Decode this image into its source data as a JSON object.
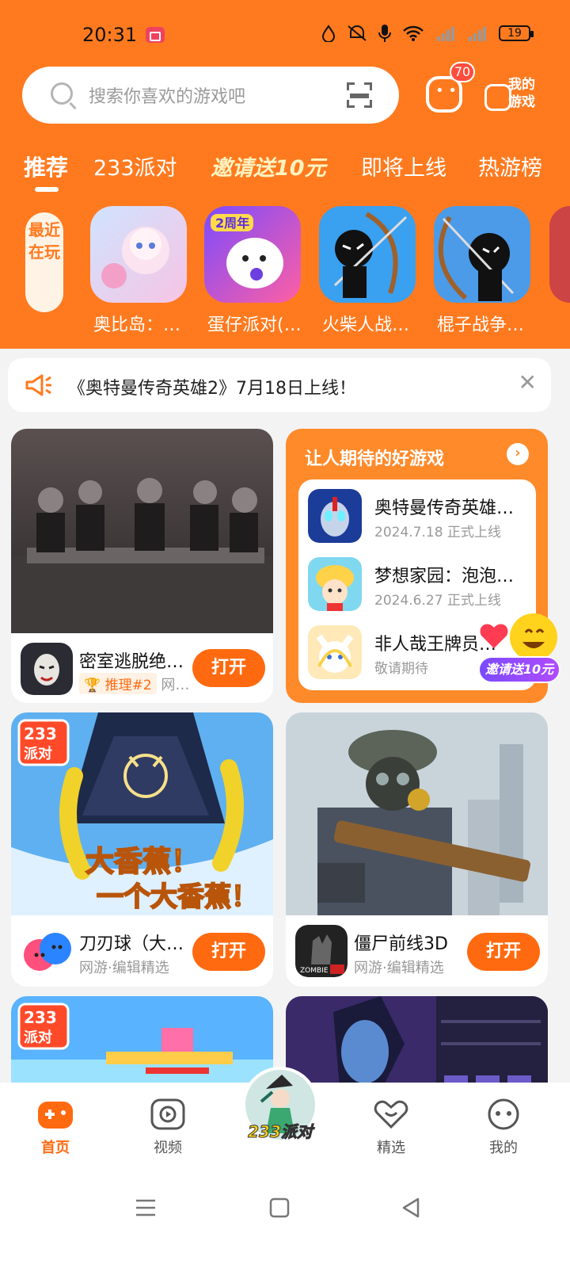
{
  "status": {
    "time": "20:31",
    "battery": "19"
  },
  "search": {
    "placeholder": "搜索你喜欢的游戏吧"
  },
  "messages": {
    "badge": "70"
  },
  "my_games": {
    "label": "我的游戏"
  },
  "tabs": [
    {
      "label": "推荐"
    },
    {
      "label": "233派对"
    },
    {
      "label": "邀请送10元"
    },
    {
      "label": "即将上线"
    },
    {
      "label": "热游榜"
    }
  ],
  "recent": {
    "label": "最近在玩",
    "items": [
      {
        "name": "奥比岛：…"
      },
      {
        "name": "蛋仔派对(…"
      },
      {
        "name": "火柴人战…"
      },
      {
        "name": "棍子战争…"
      }
    ]
  },
  "notice": {
    "text": "《奥特曼传奇英雄2》7月18日上线！"
  },
  "cards": [
    {
      "name": "密室逃脱绝…",
      "rank": "推理#2",
      "sub": "网…",
      "button": "打开"
    },
    {
      "name": "刀刃球（大…",
      "sub": "网游·编辑精选",
      "button": "打开"
    },
    {
      "name": "僵尸前线3D",
      "sub": "网游·编辑精选",
      "button": "打开"
    }
  ],
  "upcoming": {
    "title": "让人期待的好游戏",
    "items": [
      {
        "name": "奥特曼传奇英雄…",
        "date": "2024.7.18 正式上线"
      },
      {
        "name": "梦想家园：泡泡…",
        "date": "2024.6.27 正式上线"
      },
      {
        "name": "非人哉王牌员…",
        "date": "敬请期待"
      }
    ]
  },
  "float_invite": {
    "label": "邀请送10元"
  },
  "art_text": {
    "party_badge_line1": "233",
    "party_badge_line2": "派对",
    "banana_line1": "大香蕉！",
    "banana_line2": "一个大香蕉！",
    "zombie_logo": "ZOMBIE"
  },
  "bottom_nav": [
    {
      "label": "首页"
    },
    {
      "label": "视频"
    },
    {
      "label": "233派对"
    },
    {
      "label": "精选"
    },
    {
      "label": "我的"
    }
  ],
  "colors": {
    "brand_orange": "#ff7a1f",
    "button_orange": "#ff6a10"
  },
  "icons": [
    "search-icon",
    "scan-icon",
    "message-icon",
    "gamepad-icon",
    "speaker-icon",
    "close-icon",
    "arrow-right-icon",
    "home-icon",
    "video-icon",
    "heart-icon",
    "profile-icon",
    "menu-icon",
    "square-icon",
    "back-icon"
  ]
}
